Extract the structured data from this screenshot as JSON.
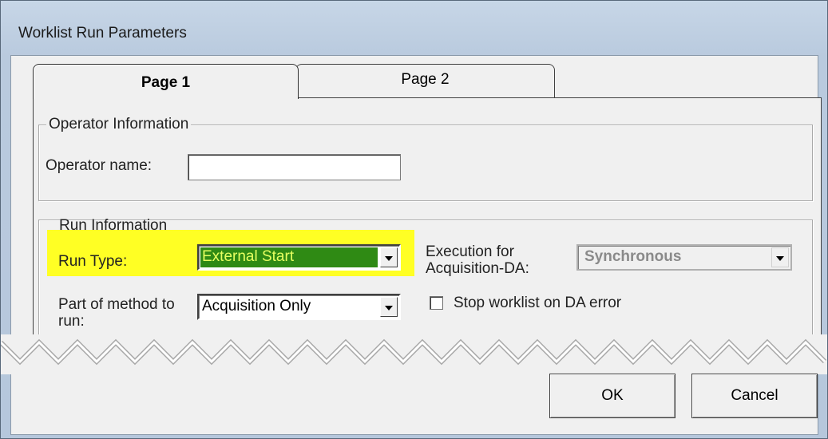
{
  "window": {
    "title": "Worklist Run Parameters"
  },
  "tabs": [
    {
      "label": "Page 1",
      "active": true
    },
    {
      "label": "Page 2",
      "active": false
    }
  ],
  "operator_group": {
    "title": "Operator Information",
    "operator_name_label": "Operator name:",
    "operator_name_value": ""
  },
  "run_group": {
    "title": "Run Information",
    "run_type_label": "Run Type:",
    "run_type_value": "External Start",
    "execution_label_line1": "Execution for",
    "execution_label_line2": "Acquisition-DA:",
    "execution_value": "Synchronous",
    "part_label_line1": "Part of method to",
    "part_label_line2": "run:",
    "part_value": "Acquisition Only",
    "stop_worklist_label": "Stop worklist on DA error",
    "stop_worklist_checked": false
  },
  "buttons": {
    "ok": "OK",
    "cancel": "Cancel"
  },
  "colors": {
    "highlight": "#ffff24",
    "run_type_bg": "#2f8a14",
    "run_type_text": "#e6ff60"
  }
}
